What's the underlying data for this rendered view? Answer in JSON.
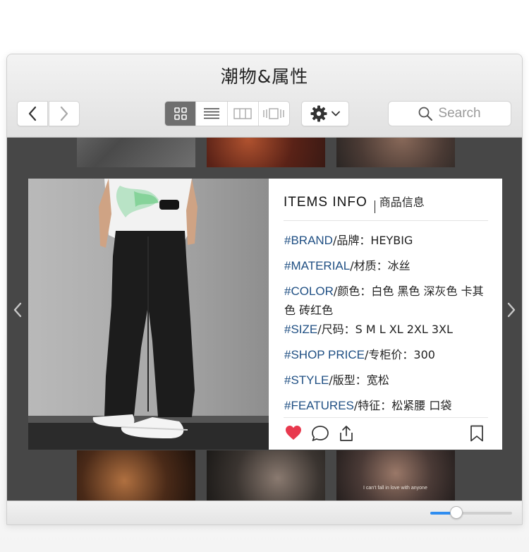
{
  "window": {
    "title": "潮物&属性"
  },
  "toolbar": {
    "back_icon": "chevron-left-icon",
    "forward_icon": "chevron-right-icon",
    "view_modes": [
      "grid-view-icon",
      "list-view-icon",
      "column-view-icon",
      "cover-flow-icon"
    ],
    "active_view": "grid-view-icon",
    "settings_icon": "gear-icon",
    "search_placeholder": "Search"
  },
  "card": {
    "header_en": "ITEMS INFO",
    "header_cn": "商品信息",
    "attributes": [
      {
        "key": "#BRAND",
        "value": "/品牌：HEYBIG"
      },
      {
        "key": "#MATERIAL",
        "value": "/材质：冰丝"
      },
      {
        "key": "#COLOR",
        "value": "/颜色：白色 黑色 深灰色 卡其色 砖红色"
      },
      {
        "key": "#SIZE",
        "value": "/尺码：S M L XL 2XL 3XL"
      },
      {
        "key": "#SHOP PRICE",
        "value": "/专柜价：300"
      },
      {
        "key": "#STYLE",
        "value": "/版型：宽松"
      },
      {
        "key": "#FEATURES",
        "value": "/特征：松紧腰 口袋"
      }
    ],
    "actions": [
      "heart-icon",
      "comment-icon",
      "share-icon",
      "bookmark-icon"
    ],
    "liked": true
  },
  "thumbnail_caption": "I can't fall in love with anyone",
  "zoom_slider": {
    "value": 0.32
  },
  "colors": {
    "accent": "#2f8df0",
    "attribute_key": "#1f4f83",
    "like": "#e8394e",
    "content_bg": "#474747"
  }
}
